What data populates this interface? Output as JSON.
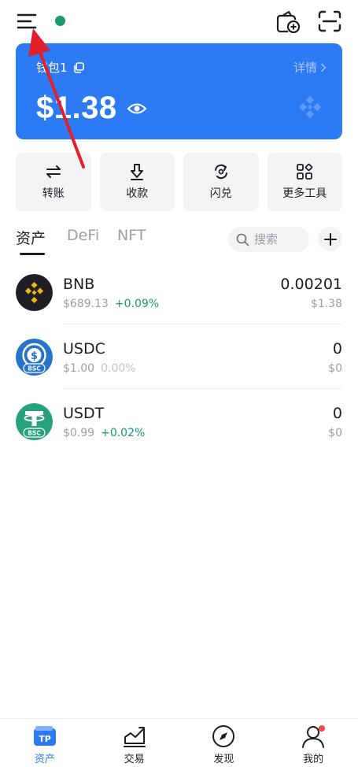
{
  "header": {
    "menu_icon": "hamburger-menu-icon",
    "status_color": "#1a9a6c",
    "wallet_add_icon": "wallet-add-icon",
    "scan_icon": "scan-icon"
  },
  "wallet": {
    "name": "钱包1",
    "detail_label": "详情",
    "balance": "$1.38",
    "card_color": "#2d7af5"
  },
  "actions": [
    {
      "label": "转账",
      "icon": "transfer-icon"
    },
    {
      "label": "收款",
      "icon": "receive-icon"
    },
    {
      "label": "闪兑",
      "icon": "swap-icon"
    },
    {
      "label": "更多工具",
      "icon": "more-tools-icon"
    }
  ],
  "tabs": [
    {
      "label": "资产",
      "active": true
    },
    {
      "label": "DeFi",
      "active": false
    },
    {
      "label": "NFT",
      "active": false
    }
  ],
  "search": {
    "placeholder": "搜索"
  },
  "tokens": [
    {
      "symbol": "BNB",
      "price": "$689.13",
      "change": "+0.09%",
      "amount": "0.00201",
      "value": "$1.38",
      "icon": "bnb-icon"
    },
    {
      "symbol": "USDC",
      "price": "$1.00",
      "change": "0.00%",
      "amount": "0",
      "value": "$0",
      "icon": "usdc-bsc-icon",
      "badge": "BSC"
    },
    {
      "symbol": "USDT",
      "price": "$0.99",
      "change": "+0.02%",
      "amount": "0",
      "value": "$0",
      "icon": "usdt-bsc-icon",
      "badge": "BSC"
    }
  ],
  "bottom_nav": [
    {
      "label": "资产",
      "icon": "tp-wallet-icon",
      "active": true
    },
    {
      "label": "交易",
      "icon": "trade-chart-icon",
      "active": false
    },
    {
      "label": "发现",
      "icon": "compass-icon",
      "active": false
    },
    {
      "label": "我的",
      "icon": "profile-icon",
      "active": false
    }
  ],
  "colors": {
    "accent": "#2d7af5",
    "positive": "#1a9a6c",
    "annotation_arrow": "#e0202a"
  }
}
